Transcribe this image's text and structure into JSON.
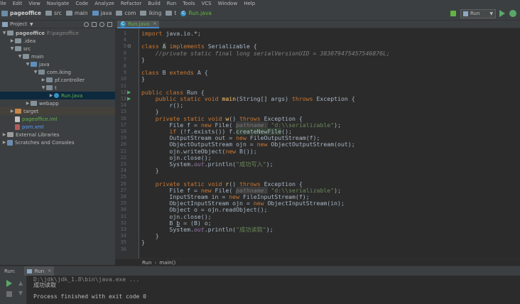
{
  "menu": [
    "File",
    "Edit",
    "View",
    "Navigate",
    "Code",
    "Analyze",
    "Refactor",
    "Build",
    "Run",
    "Tools",
    "VCS",
    "Window",
    "Help"
  ],
  "breadcrumb": {
    "project": "pageoffice",
    "items": [
      "src",
      "main",
      "java",
      "com",
      "iking",
      "t"
    ],
    "file": "Run.java"
  },
  "run_config": {
    "label": "Run"
  },
  "project_panel": {
    "title": "Project"
  },
  "tree": [
    {
      "label": "pageoffice",
      "extra": "F:\\pageoffice"
    },
    {
      "label": ".idea"
    },
    {
      "label": "src"
    },
    {
      "label": "main"
    },
    {
      "label": "java"
    },
    {
      "label": "com.iking"
    },
    {
      "label": "pf.controller"
    },
    {
      "label": "t"
    },
    {
      "label": "Run.java"
    },
    {
      "label": "webapp"
    },
    {
      "label": "target"
    },
    {
      "label": "pageoffice.iml"
    },
    {
      "label": "pom.xml"
    },
    {
      "label": "External Libraries"
    },
    {
      "label": "Scratches and Consoles"
    }
  ],
  "editor": {
    "tab": "Run.java",
    "line_numbers": [
      "1",
      "4",
      "5",
      "6",
      "7",
      "8",
      "9",
      "10",
      "11",
      "12",
      "13",
      "14",
      "15",
      "16",
      "17",
      "18",
      "19",
      "20",
      "21",
      "22",
      "23",
      "24",
      "25",
      "26",
      "27",
      "28",
      "29",
      "30",
      "31",
      "32",
      "33",
      "34",
      "35",
      "36"
    ]
  },
  "code_breadcrumb": [
    "Run",
    "main()"
  ],
  "run_panel": {
    "label": "Run:",
    "tab": "Run",
    "cmd": "D:\\jdk\\jdk_1.8\\bin\\java.exe ...",
    "output1": "成功读取",
    "output2": "Process finished with exit code 0"
  }
}
